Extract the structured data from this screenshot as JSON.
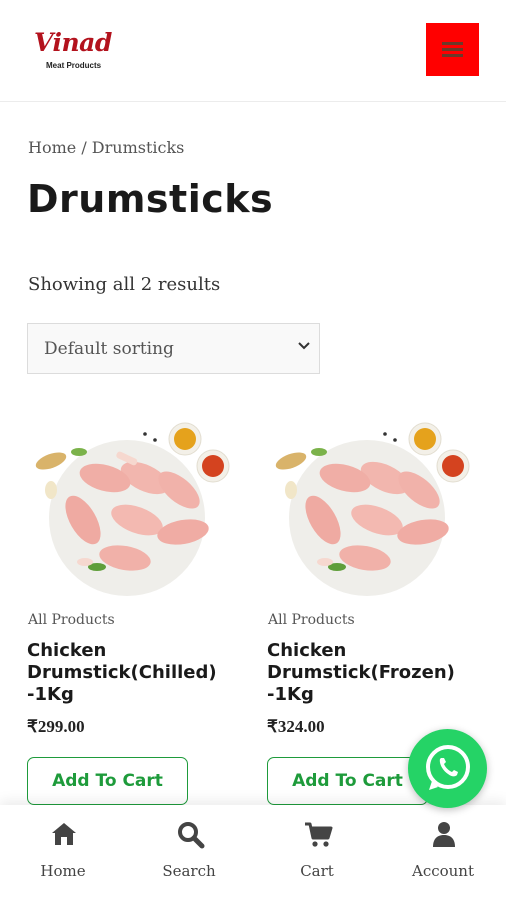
{
  "header": {
    "logo_script": "Vinad",
    "logo_sub": "Meat Products",
    "menu_label": "menu"
  },
  "breadcrumb": {
    "home": "Home",
    "separator": " / ",
    "current": "Drumsticks"
  },
  "page_title": "Drumsticks",
  "result_count": "Showing all 2 results",
  "sorting": {
    "selected": "Default sorting"
  },
  "products": [
    {
      "category": "All Products",
      "name": "Chicken Drumstick(Chilled) -1Kg",
      "price": "₹299.00",
      "button": "Add To Cart"
    },
    {
      "category": "All Products",
      "name": "Chicken Drumstick(Frozen) -1Kg",
      "price": "₹324.00",
      "button": "Add To Cart"
    }
  ],
  "bottom_nav": [
    {
      "label": "Home",
      "icon": "home-icon"
    },
    {
      "label": "Search",
      "icon": "search-icon"
    },
    {
      "label": "Cart",
      "icon": "cart-icon"
    },
    {
      "label": "Account",
      "icon": "user-icon"
    }
  ],
  "colors": {
    "brand_red": "#b3121d",
    "menu_button": "#ff0000",
    "add_to_cart_green": "#1e9b3b",
    "whatsapp_green": "#25d366"
  }
}
